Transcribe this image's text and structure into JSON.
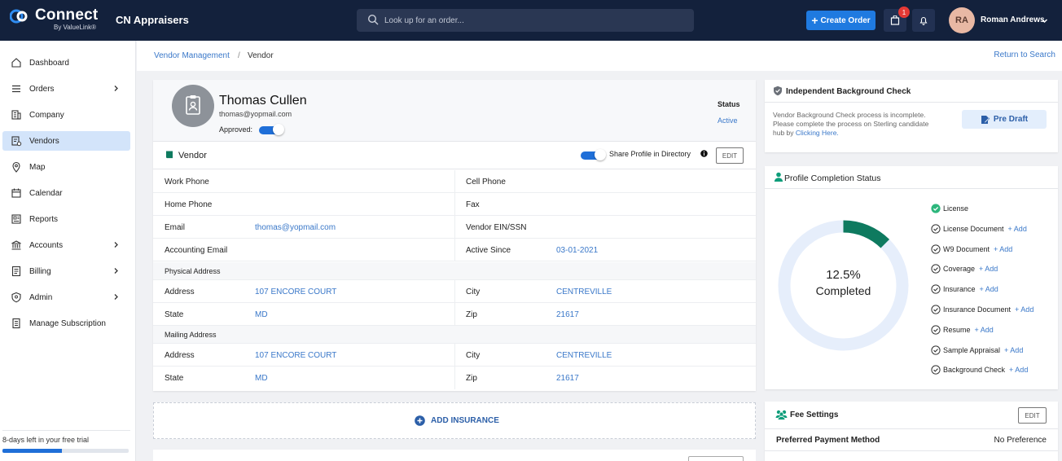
{
  "header": {
    "logo_title": "Connect",
    "logo_sub": "By ValueLink®",
    "company": "CN Appraisers",
    "search_placeholder": "Look up for an order...",
    "create_order_label": "Create Order",
    "notification_count": "1",
    "user_initials": "RA",
    "user_name": "Roman Andrews"
  },
  "sidebar": {
    "items": [
      {
        "label": "Dashboard",
        "icon": "home-icon",
        "has_children": false
      },
      {
        "label": "Orders",
        "icon": "list-icon",
        "has_children": true
      },
      {
        "label": "Company",
        "icon": "building-icon",
        "has_children": false
      },
      {
        "label": "Vendors",
        "icon": "vendor-icon",
        "has_children": false,
        "active": true
      },
      {
        "label": "Map",
        "icon": "map-pin-icon",
        "has_children": false
      },
      {
        "label": "Calendar",
        "icon": "calendar-icon",
        "has_children": false
      },
      {
        "label": "Reports",
        "icon": "reports-icon",
        "has_children": false
      },
      {
        "label": "Accounts",
        "icon": "bank-icon",
        "has_children": true
      },
      {
        "label": "Billing",
        "icon": "billing-icon",
        "has_children": true
      },
      {
        "label": "Admin",
        "icon": "shield-icon",
        "has_children": true
      },
      {
        "label": "Manage Subscription",
        "icon": "subscription-icon",
        "has_children": false
      }
    ],
    "trial_text": "8-days left in your free trial",
    "trial_progress": 0.47
  },
  "breadcrumb": {
    "parent": "Vendor Management",
    "separator": "/",
    "current": "Vendor",
    "return_label": "Return to Search"
  },
  "vendor": {
    "name": "Thomas Cullen",
    "email": "thomas@yopmail.com",
    "approved_label": "Approved:",
    "approved": true,
    "status_label": "Status",
    "status_value": "Active",
    "section_title": "Vendor",
    "share_label": "Share Profile in Directory",
    "share_enabled": true,
    "edit_label": "EDIT",
    "fields": {
      "work_phone": {
        "label": "Work Phone",
        "value": ""
      },
      "cell_phone": {
        "label": "Cell Phone",
        "value": ""
      },
      "home_phone": {
        "label": "Home Phone",
        "value": ""
      },
      "fax": {
        "label": "Fax",
        "value": ""
      },
      "email": {
        "label": "Email",
        "value": "thomas@yopmail.com"
      },
      "ein": {
        "label": "Vendor EIN/SSN",
        "value": ""
      },
      "accounting_email": {
        "label": "Accounting Email",
        "value": ""
      },
      "active_since": {
        "label": "Active Since",
        "value": "03-01-2021"
      }
    },
    "physical_address": {
      "heading": "Physical Address",
      "address_label": "Address",
      "address": "107 ENCORE COURT",
      "city_label": "City",
      "city": "CENTREVILLE",
      "state_label": "State",
      "state": "MD",
      "zip_label": "Zip",
      "zip": "21617"
    },
    "mailing_address": {
      "heading": "Mailing Address",
      "address_label": "Address",
      "address": "107 ENCORE COURT",
      "city_label": "City",
      "city": "CENTREVILLE",
      "state_label": "State",
      "state": "MD",
      "zip_label": "Zip",
      "zip": "21617"
    },
    "add_insurance_label": "ADD INSURANCE"
  },
  "background_check": {
    "title": "Independent Background Check",
    "text": "Vendor Background Check process is incomplete. Please complete the process on Sterling candidate hub by ",
    "link_text": "Clicking Here.",
    "button_label": "Pre Draft"
  },
  "profile_completion": {
    "title": "Profile Completion Status",
    "percent_text": "12.5%",
    "completed_label": "Completed",
    "percent": 12.5,
    "colors": {
      "done": "#0e7a5f",
      "remaining": "#e6eefb"
    },
    "add_label": "+ Add",
    "items": [
      {
        "name": "License",
        "done": true
      },
      {
        "name": "License Document",
        "done": false
      },
      {
        "name": "W9 Document",
        "done": false
      },
      {
        "name": "Coverage",
        "done": false
      },
      {
        "name": "Insurance",
        "done": false
      },
      {
        "name": "Insurance Document",
        "done": false
      },
      {
        "name": "Resume",
        "done": false
      },
      {
        "name": "Sample Appraisal",
        "done": false
      },
      {
        "name": "Background Check",
        "done": false
      }
    ]
  },
  "fee_settings": {
    "title": "Fee Settings",
    "edit_label": "EDIT",
    "preferred_payment_label": "Preferred Payment Method",
    "preferred_payment_value": "No Preference"
  }
}
